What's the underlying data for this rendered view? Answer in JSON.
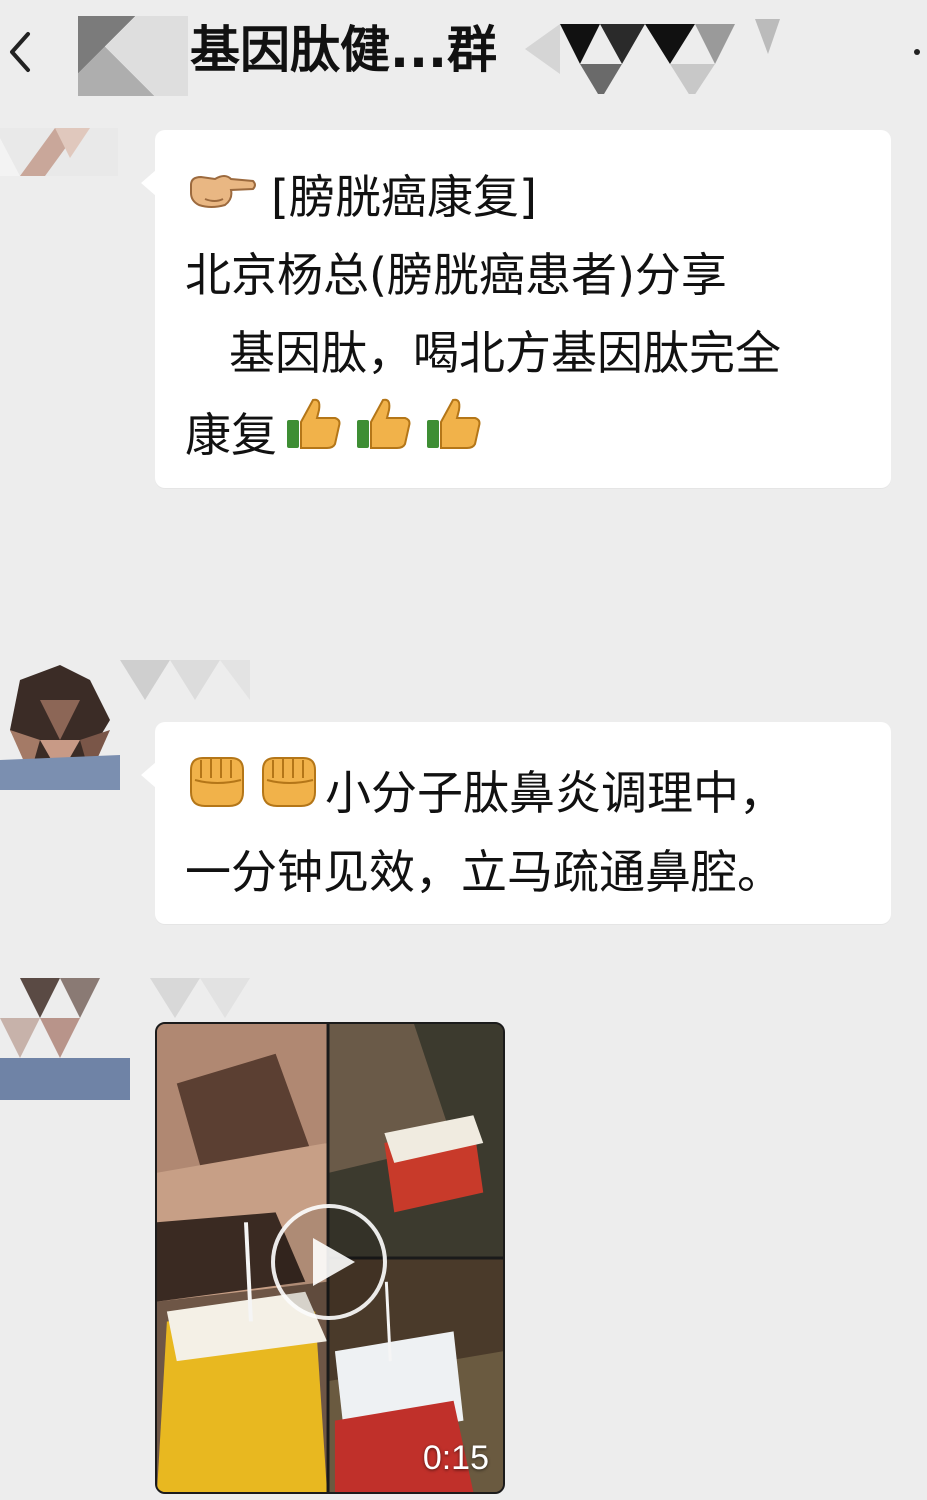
{
  "header": {
    "title": "基因肽健...群",
    "back_icon": "chevron-left-icon",
    "more_icon": "more-dots-icon"
  },
  "messages": [
    {
      "lines": [
        "[膀胱癌康复]",
        "北京杨总(膀胱癌患者)分享",
        "基因肽，喝北方基因肽完全",
        "康复"
      ],
      "lead_emoji": "pointing-finger-icon",
      "trail_emojis": [
        "thumbs-up-icon",
        "thumbs-up-icon",
        "thumbs-up-icon"
      ]
    },
    {
      "lines": [
        "小分子肽鼻炎调理中，",
        "一分钟见效，立马疏通鼻腔。"
      ],
      "lead_emojis": [
        "fist-icon",
        "fist-icon"
      ]
    }
  ],
  "video": {
    "duration": "0:15",
    "play_icon": "play-icon"
  },
  "colors": {
    "background": "#ededed",
    "bubble": "#ffffff",
    "text": "#111111"
  }
}
